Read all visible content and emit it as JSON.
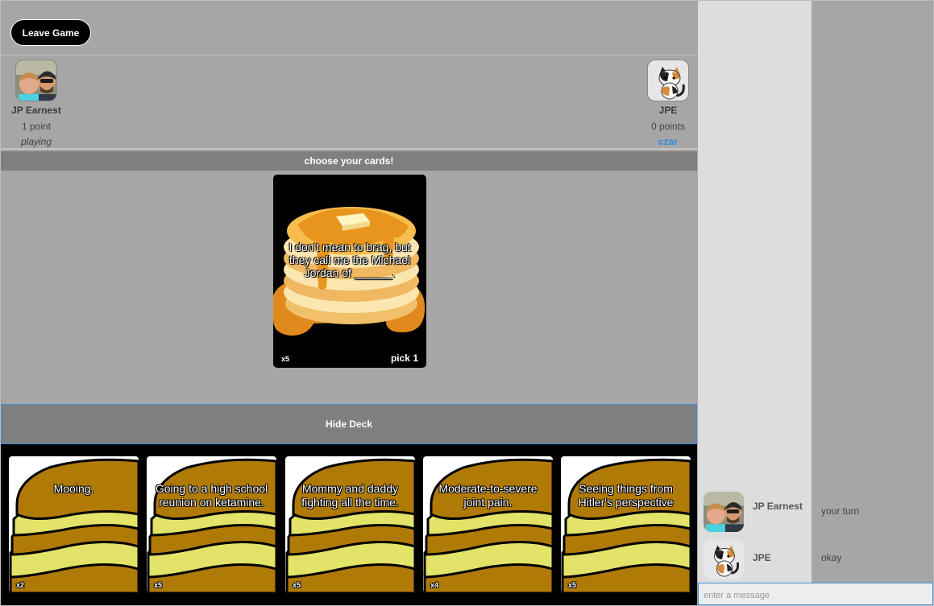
{
  "header": {
    "leave_label": "Leave Game"
  },
  "players": [
    {
      "name": "JP Earnest",
      "score": "1 point",
      "status": "playing"
    },
    {
      "name": "JPE",
      "score": "0 points",
      "status": "czar"
    }
  ],
  "status_strip": "choose your cards!",
  "black_card": {
    "text": "I don't mean to brag, but they call me the Michael Jordan of ______.",
    "count": "x5",
    "pick": "pick 1"
  },
  "hide_deck_label": "Hide Deck",
  "hand": [
    {
      "text": "Mooing.",
      "count": "x2"
    },
    {
      "text": "Going to a high school reunion on ketamine.",
      "count": "x5"
    },
    {
      "text": "Mommy and daddy fighting all the time.",
      "count": "x5"
    },
    {
      "text": "Moderate-to-severe joint pain.",
      "count": "x4"
    },
    {
      "text": "Seeing things from Hitler's perspective",
      "count": "x5"
    }
  ],
  "chat": {
    "messages": [
      {
        "name": "JP Earnest",
        "text": "your turn"
      },
      {
        "name": "JPE",
        "text": "okay"
      }
    ],
    "input_placeholder": "enter a message"
  },
  "colors": {
    "czar": "#2e8bdc",
    "accent_border": "#3d8fd8",
    "pancake": "#b07a07",
    "butter": "#e3e36a"
  },
  "icons": {
    "player_avatar": "selfie-photo-icon",
    "czar_avatar": "calico-cat-icon"
  }
}
